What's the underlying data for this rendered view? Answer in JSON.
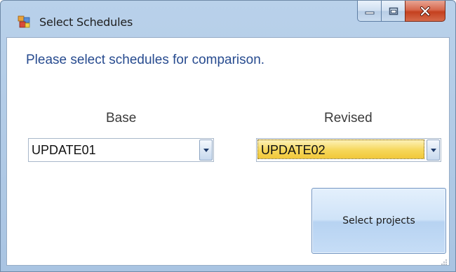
{
  "window": {
    "title": "Select Schedules",
    "app_icon": "form-icon",
    "caption_buttons": [
      "minimize-icon",
      "maximize-icon",
      "close-icon"
    ]
  },
  "content": {
    "prompt": "Please select schedules for comparison.",
    "base": {
      "label": "Base",
      "selected": "UPDATE01"
    },
    "revised": {
      "label": "Revised",
      "selected": "UPDATE02"
    },
    "select_button_label": "Select projects"
  },
  "colors": {
    "title_bar": "#b9d1ea",
    "prompt_text": "#274b8f",
    "close_button": "#c4401f",
    "selection_highlight": "#f6d75a",
    "button_face": "#cfe3f8"
  }
}
